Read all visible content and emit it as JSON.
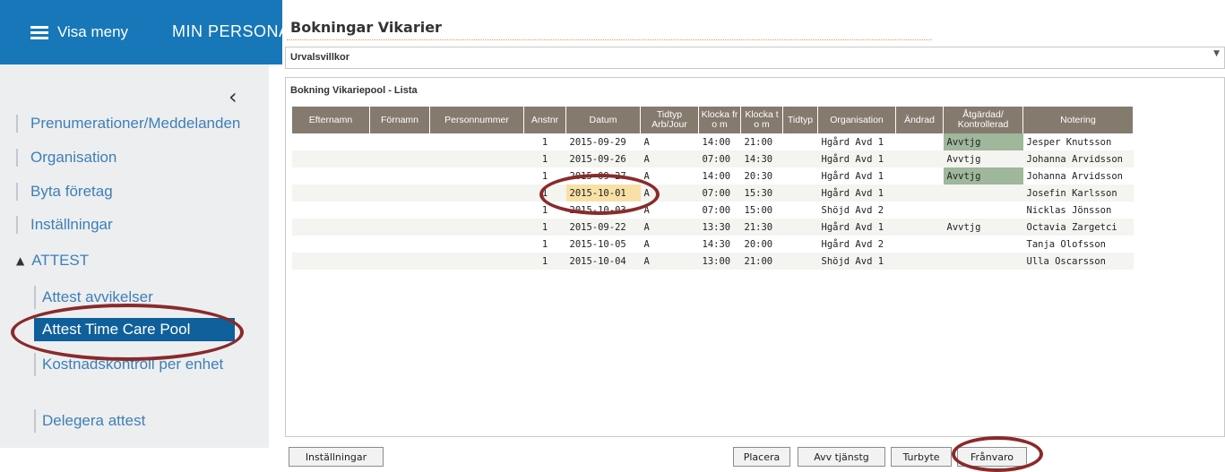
{
  "header": {
    "menu_label": "Visa meny",
    "app_title": "MIN PERSONAL"
  },
  "sidebar": {
    "collapse_glyph": "‹",
    "items": [
      {
        "label": "Prenumerationer/Meddelanden"
      },
      {
        "label": "Organisation"
      },
      {
        "label": "Byta företag"
      },
      {
        "label": "Inställningar"
      }
    ],
    "section": {
      "label": "ATTEST",
      "expanded": true
    },
    "sub_items": [
      {
        "label": "Attest avvikelser"
      },
      {
        "label": "Attest Time Care Pool",
        "active": true
      },
      {
        "label": "Kostnadskontroll per enhet"
      },
      {
        "label": "Delegera attest"
      }
    ]
  },
  "main": {
    "title": "Bokningar Vikarier",
    "filter_label": "Urvalsvillkor",
    "list_title": "Bokning Vikariepool - Lista",
    "columns": [
      "Efternamn",
      "Förnamn",
      "Personnummer",
      "Anstnr",
      "Datum",
      "Tidtyp Arb/Jour",
      "Klocka fr o m",
      "Klocka t o m",
      "Tidtyp",
      "Organisation",
      "Ändrad",
      "Åtgärdad/ Kontrollerad",
      "Notering"
    ],
    "rows": [
      {
        "anstnr": "1",
        "datum": "2015-09-29",
        "tidtyp": "A",
        "from": "14:00",
        "tom": "21:00",
        "org": "Hgård Avd 1",
        "atgard": "Avvtjg",
        "notering": "Jesper Knutsson"
      },
      {
        "anstnr": "1",
        "datum": "2015-09-26",
        "tidtyp": "A",
        "from": "07:00",
        "tom": "14:30",
        "org": "Hgård Avd 1",
        "atgard": "Avvtjg",
        "notering": "Johanna Arvidsson"
      },
      {
        "anstnr": "1",
        "datum": "2015-09-27",
        "tidtyp": "A",
        "from": "14:00",
        "tom": "20:30",
        "org": "Hgård Avd 1",
        "atgard": "Avvtjg",
        "notering": "Johanna Arvidsson"
      },
      {
        "anstnr": "1",
        "datum": "2015-10-01",
        "tidtyp": "A",
        "from": "07:00",
        "tom": "15:30",
        "org": "Hgård Avd 1",
        "atgard": "",
        "notering": "Josefin Karlsson"
      },
      {
        "anstnr": "1",
        "datum": "2015-10-03",
        "tidtyp": "A",
        "from": "07:00",
        "tom": "15:00",
        "org": "Shöjd Avd 2",
        "atgard": "",
        "notering": "Nicklas Jönsson"
      },
      {
        "anstnr": "1",
        "datum": "2015-09-22",
        "tidtyp": "A",
        "from": "13:30",
        "tom": "21:30",
        "org": "Hgård Avd 1",
        "atgard": "Avvtjg",
        "notering": "Octavia Zargetci"
      },
      {
        "anstnr": "1",
        "datum": "2015-10-05",
        "tidtyp": "A",
        "from": "14:30",
        "tom": "20:00",
        "org": "Hgård Avd 2",
        "atgard": "",
        "notering": "Tanja Olofsson"
      },
      {
        "anstnr": "1",
        "datum": "2015-10-04",
        "tidtyp": "A",
        "from": "13:00",
        "tom": "21:00",
        "org": "Shöjd Avd 1",
        "atgard": "",
        "notering": "Ulla Oscarsson"
      }
    ]
  },
  "buttons": {
    "installningar": "Inställningar",
    "placera": "Placera",
    "avv_tjanstg": "Avv tjänstg",
    "turbyte": "Turbyte",
    "franvaro": "Frånvaro"
  },
  "colors": {
    "topbar": "#1777b8",
    "active_item": "#0f5f9b",
    "link": "#3f7fb5",
    "header_row": "#847a6e",
    "highlight_date": "#f8e1a6",
    "status_green": "#9fb79b",
    "annotation_ring": "#8a2a2a"
  }
}
